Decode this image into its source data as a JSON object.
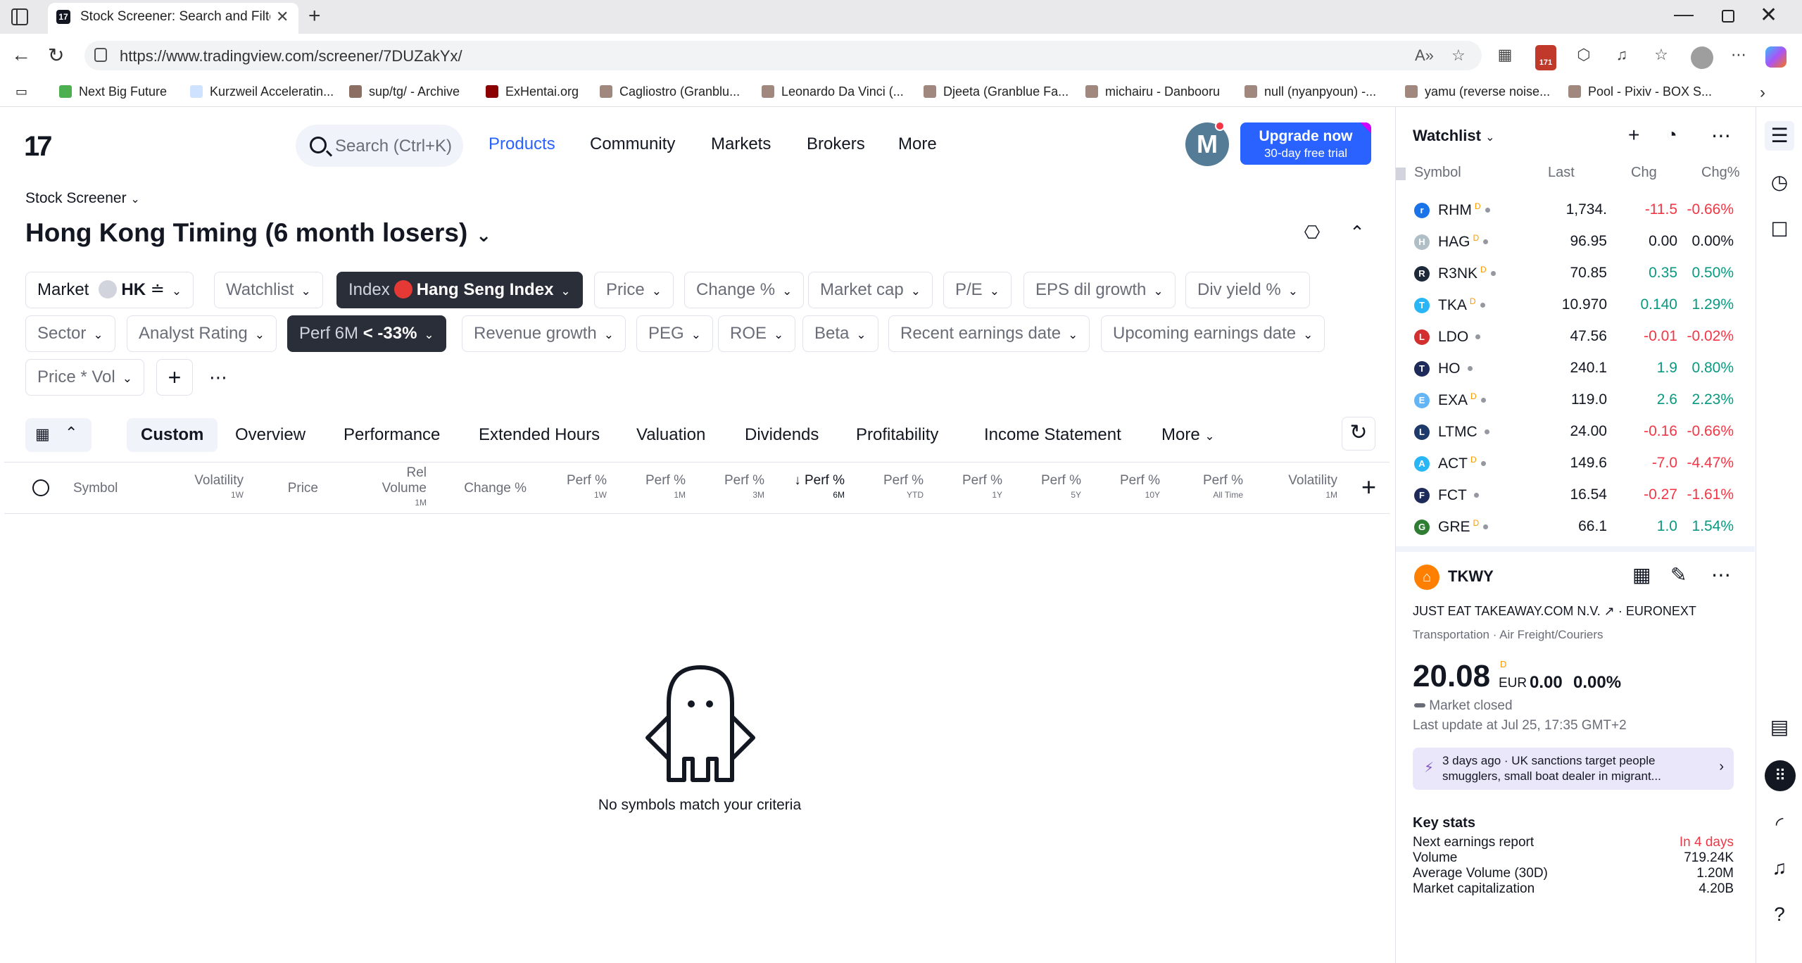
{
  "browser": {
    "tab_title": "Stock Screener: Search and Filter S",
    "url": "https://www.tradingview.com/screener/7DUZakYx/",
    "ext_badge": "171",
    "bookmarks": [
      {
        "label": "Next Big Future",
        "color": "#4caf50"
      },
      {
        "label": "Kurzweil Acceleratin...",
        "color": "#cfe2ff"
      },
      {
        "label": "sup/tg/ - Archive",
        "color": "#8d6e63"
      },
      {
        "label": "ExHentai.org",
        "color": "#8b0000"
      },
      {
        "label": "Cagliostro (Granblu...",
        "color": "#a1887f"
      },
      {
        "label": "Leonardo Da Vinci (...",
        "color": "#a1887f"
      },
      {
        "label": "Djeeta (Granblue Fa...",
        "color": "#a1887f"
      },
      {
        "label": "michairu - Danbooru",
        "color": "#a1887f"
      },
      {
        "label": "null (nyanpyoun) -...",
        "color": "#a1887f"
      },
      {
        "label": "yamu (reverse noise...",
        "color": "#a1887f"
      },
      {
        "label": "Pool - Pixiv - BOX S...",
        "color": "#a1887f"
      }
    ]
  },
  "header": {
    "search_placeholder": "Search (Ctrl+K)",
    "nav": [
      "Products",
      "Community",
      "Markets",
      "Brokers",
      "More"
    ],
    "avatar_letter": "M",
    "upgrade_main": "Upgrade now",
    "upgrade_sub": "30-day free trial"
  },
  "screener": {
    "breadcrumb": "Stock Screener",
    "title": "Hong Kong Timing (6 month losers)",
    "filters_row1": {
      "market_label": "Market",
      "market_value": "HK",
      "watchlist": "Watchlist",
      "index_label": "Index",
      "index_value": "Hang Seng Index",
      "price": "Price",
      "change": "Change %",
      "market_cap": "Market cap",
      "pe": "P/E",
      "eps": "EPS dil growth",
      "div": "Div yield %"
    },
    "filters_row2": {
      "sector": "Sector",
      "analyst": "Analyst Rating",
      "perf_label": "Perf 6M",
      "perf_op": "<",
      "perf_value": "-33%",
      "revenue": "Revenue growth",
      "peg": "PEG",
      "roe": "ROE",
      "beta": "Beta",
      "recent_earn": "Recent earnings date",
      "upcoming_earn": "Upcoming earnings date"
    },
    "filters_row3": {
      "price_vol": "Price * Vol"
    },
    "tabs": [
      "Custom",
      "Overview",
      "Performance",
      "Extended Hours",
      "Valuation",
      "Dividends",
      "Profitability",
      "Income Statement",
      "More"
    ],
    "columns": [
      {
        "label": "Symbol",
        "sub": ""
      },
      {
        "label": "Volatility",
        "sub": "1W"
      },
      {
        "label": "Price",
        "sub": ""
      },
      {
        "label": "Rel",
        "label2": "Volume",
        "sub": "1M"
      },
      {
        "label": "Change %",
        "sub": ""
      },
      {
        "label": "Perf %",
        "sub": "1W"
      },
      {
        "label": "Perf %",
        "sub": "1M"
      },
      {
        "label": "Perf %",
        "sub": "3M"
      },
      {
        "label": "Perf %",
        "sub": "6M"
      },
      {
        "label": "Perf %",
        "sub": "YTD"
      },
      {
        "label": "Perf %",
        "sub": "1Y"
      },
      {
        "label": "Perf %",
        "sub": "5Y"
      },
      {
        "label": "Perf %",
        "sub": "10Y"
      },
      {
        "label": "Perf %",
        "sub": "All Time"
      },
      {
        "label": "Volatility",
        "sub": "1M"
      }
    ],
    "empty_message": "No symbols match your criteria"
  },
  "watchlist": {
    "title": "Watchlist",
    "col_symbol": "Symbol",
    "col_last": "Last",
    "col_chg": "Chg",
    "col_chgp": "Chg%",
    "rows": [
      {
        "sym": "RHM",
        "d": "D",
        "last": "1,734.",
        "chg": "-11.5",
        "chgp": "-0.66%",
        "dir": "neg",
        "color": "#1a73e8",
        "glyph": "r"
      },
      {
        "sym": "HAG",
        "d": "D",
        "last": "96.95",
        "chg": "0.00",
        "chgp": "0.00%",
        "dir": "neu",
        "color": "#b0bec5",
        "glyph": "H"
      },
      {
        "sym": "R3NK",
        "d": "D",
        "last": "70.85",
        "chg": "0.35",
        "chgp": "0.50%",
        "dir": "pos",
        "color": "#1e2a3a",
        "glyph": "R"
      },
      {
        "sym": "TKA",
        "d": "D",
        "last": "10.970",
        "chg": "0.140",
        "chgp": "1.29%",
        "dir": "pos",
        "color": "#29b6f6",
        "glyph": "T"
      },
      {
        "sym": "LDO",
        "d": "",
        "last": "47.56",
        "chg": "-0.01",
        "chgp": "-0.02%",
        "dir": "neg",
        "color": "#d32f2f",
        "glyph": "L"
      },
      {
        "sym": "HO",
        "d": "",
        "last": "240.1",
        "chg": "1.9",
        "chgp": "0.80%",
        "dir": "pos",
        "color": "#1e2a5a",
        "glyph": "T"
      },
      {
        "sym": "EXA",
        "d": "D",
        "last": "119.0",
        "chg": "2.6",
        "chgp": "2.23%",
        "dir": "pos",
        "color": "#64b5f6",
        "glyph": "E"
      },
      {
        "sym": "LTMC",
        "d": "",
        "last": "24.00",
        "chg": "-0.16",
        "chgp": "-0.66%",
        "dir": "neg",
        "color": "#1e3a6a",
        "glyph": "L"
      },
      {
        "sym": "ACT",
        "d": "D",
        "last": "149.6",
        "chg": "-7.0",
        "chgp": "-4.47%",
        "dir": "neg",
        "color": "#29b6f6",
        "glyph": "A"
      },
      {
        "sym": "FCT",
        "d": "",
        "last": "16.54",
        "chg": "-0.27",
        "chgp": "-1.61%",
        "dir": "neg",
        "color": "#1e2a5a",
        "glyph": "F"
      },
      {
        "sym": "GRE",
        "d": "D",
        "last": "66.1",
        "chg": "1.0",
        "chgp": "1.54%",
        "dir": "pos",
        "color": "#2e7d32",
        "glyph": "G"
      }
    ]
  },
  "details": {
    "symbol": "TKWY",
    "name": "JUST EAT TAKEAWAY.COM N.V.",
    "exchange": "EURONEXT",
    "sector": "Transportation",
    "industry": "Air Freight/Couriers",
    "price": "20.08",
    "price_flag": "D",
    "currency": "EUR",
    "chg": "0.00",
    "chgp": "0.00%",
    "status": "Market closed",
    "last_update": "Last update at Jul 25, 17:35 GMT+2",
    "news_time": "3 days ago",
    "news_text": "UK sanctions target people smugglers, small boat dealer in migrant...",
    "key_stats_title": "Key stats",
    "stats": [
      {
        "label": "Next earnings report",
        "value": "In 4 days",
        "red": true
      },
      {
        "label": "Volume",
        "value": "719.24K",
        "red": false
      },
      {
        "label": "Average Volume (30D)",
        "value": "1.20M",
        "red": false
      },
      {
        "label": "Market capitalization",
        "value": "4.20B",
        "red": false
      }
    ]
  }
}
